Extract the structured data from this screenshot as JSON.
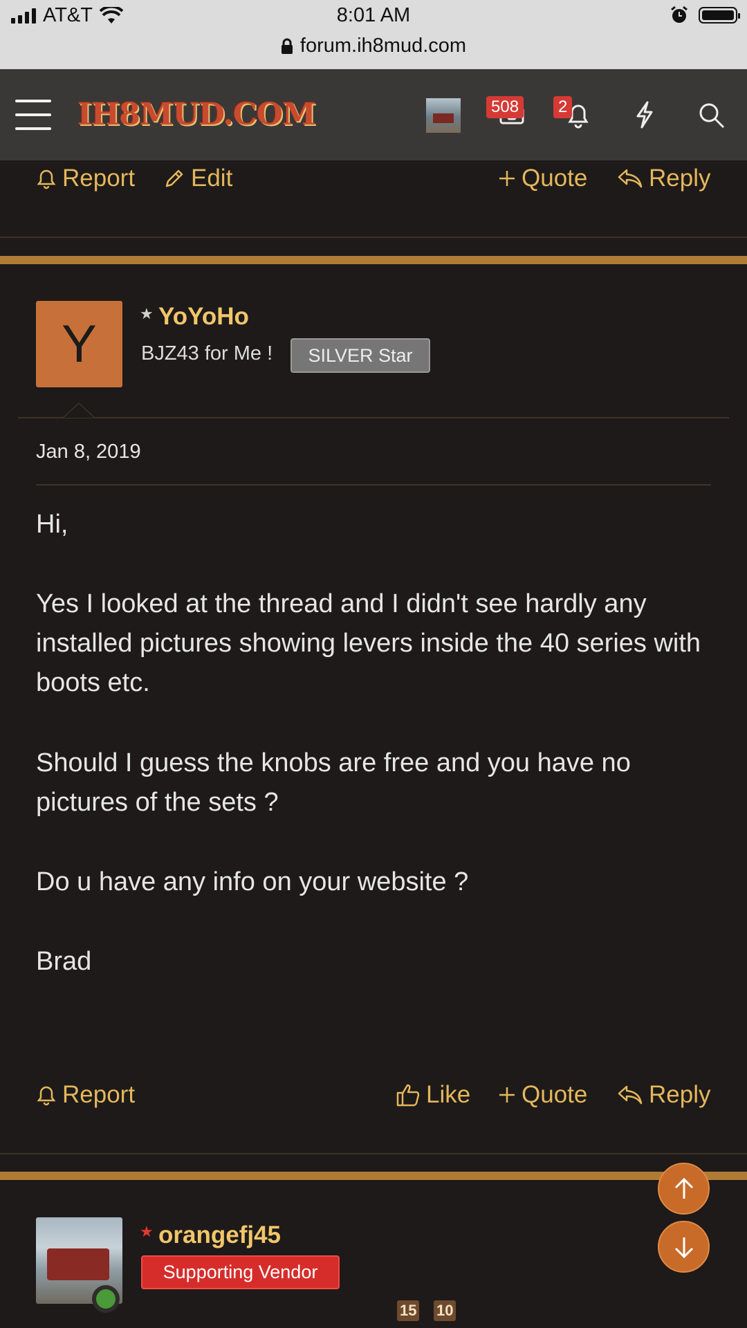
{
  "status_bar": {
    "carrier": "AT&T",
    "time": "8:01 AM",
    "url": "forum.ih8mud.com"
  },
  "header": {
    "logo_text": "IH8MUD.COM",
    "inbox_count": "508",
    "alerts_count": "2"
  },
  "post_actions_top": {
    "report": "Report",
    "edit": "Edit",
    "quote": "Quote",
    "reply": "Reply"
  },
  "post": {
    "username": "YoYoHo",
    "user_title": "BJZ43 for Me !",
    "banner": "SILVER Star",
    "avatar_letter": "Y",
    "date": "Jan 8, 2019",
    "paragraphs": [
      "Hi,",
      "Yes I looked at the thread and I didn't see hardly any installed pictures showing levers inside the 40 series with boots etc.",
      "Should I guess the knobs are free and you have no pictures of the sets ?",
      "Do u have any info on your website ?",
      "Brad"
    ]
  },
  "post_actions_bottom": {
    "report": "Report",
    "like": "Like",
    "quote": "Quote",
    "reply": "Reply"
  },
  "next_post": {
    "username": "orangefj45",
    "banner": "Supporting Vendor",
    "trophies": [
      "15",
      "10"
    ]
  },
  "colors": {
    "accent": "#e5b75b",
    "divider_bar": "#b07c35",
    "background": "#1d1a19",
    "header_bg": "#3a3837"
  }
}
